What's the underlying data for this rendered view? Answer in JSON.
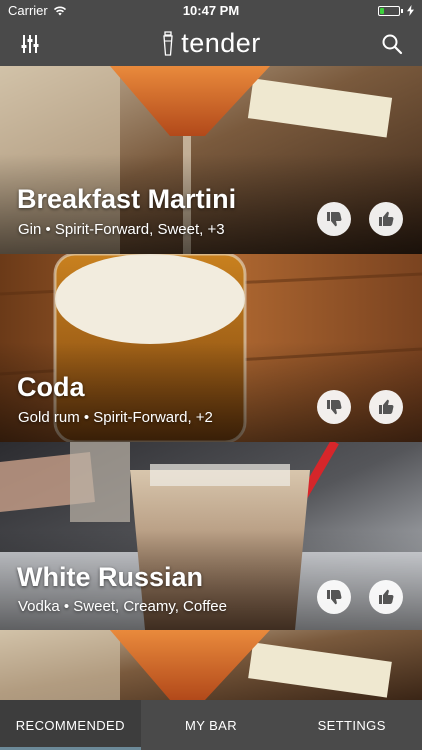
{
  "status_bar": {
    "carrier": "Carrier",
    "time": "10:47 PM",
    "battery_level_percent": 20,
    "battery_fill_color": "#3cd13c"
  },
  "nav": {
    "title": "tender",
    "left_icon": "filter-sliders-icon",
    "right_icon": "search-icon"
  },
  "cards": [
    {
      "name": "Breakfast Martini",
      "description": "Gin • Spirit-Forward, Sweet, +3"
    },
    {
      "name": "Coda",
      "description": "Gold rum • Spirit-Forward, +2"
    },
    {
      "name": "White Russian",
      "description": "Vodka • Sweet, Creamy, Coffee"
    }
  ],
  "tabs": [
    {
      "label": "RECOMMENDED",
      "active": true
    },
    {
      "label": "MY BAR",
      "active": false
    },
    {
      "label": "SETTINGS",
      "active": false
    }
  ],
  "colors": {
    "bar_background": "#4a4a4a",
    "active_tab_indicator": "#6c8a99",
    "vote_button_background": "#ffffff"
  }
}
